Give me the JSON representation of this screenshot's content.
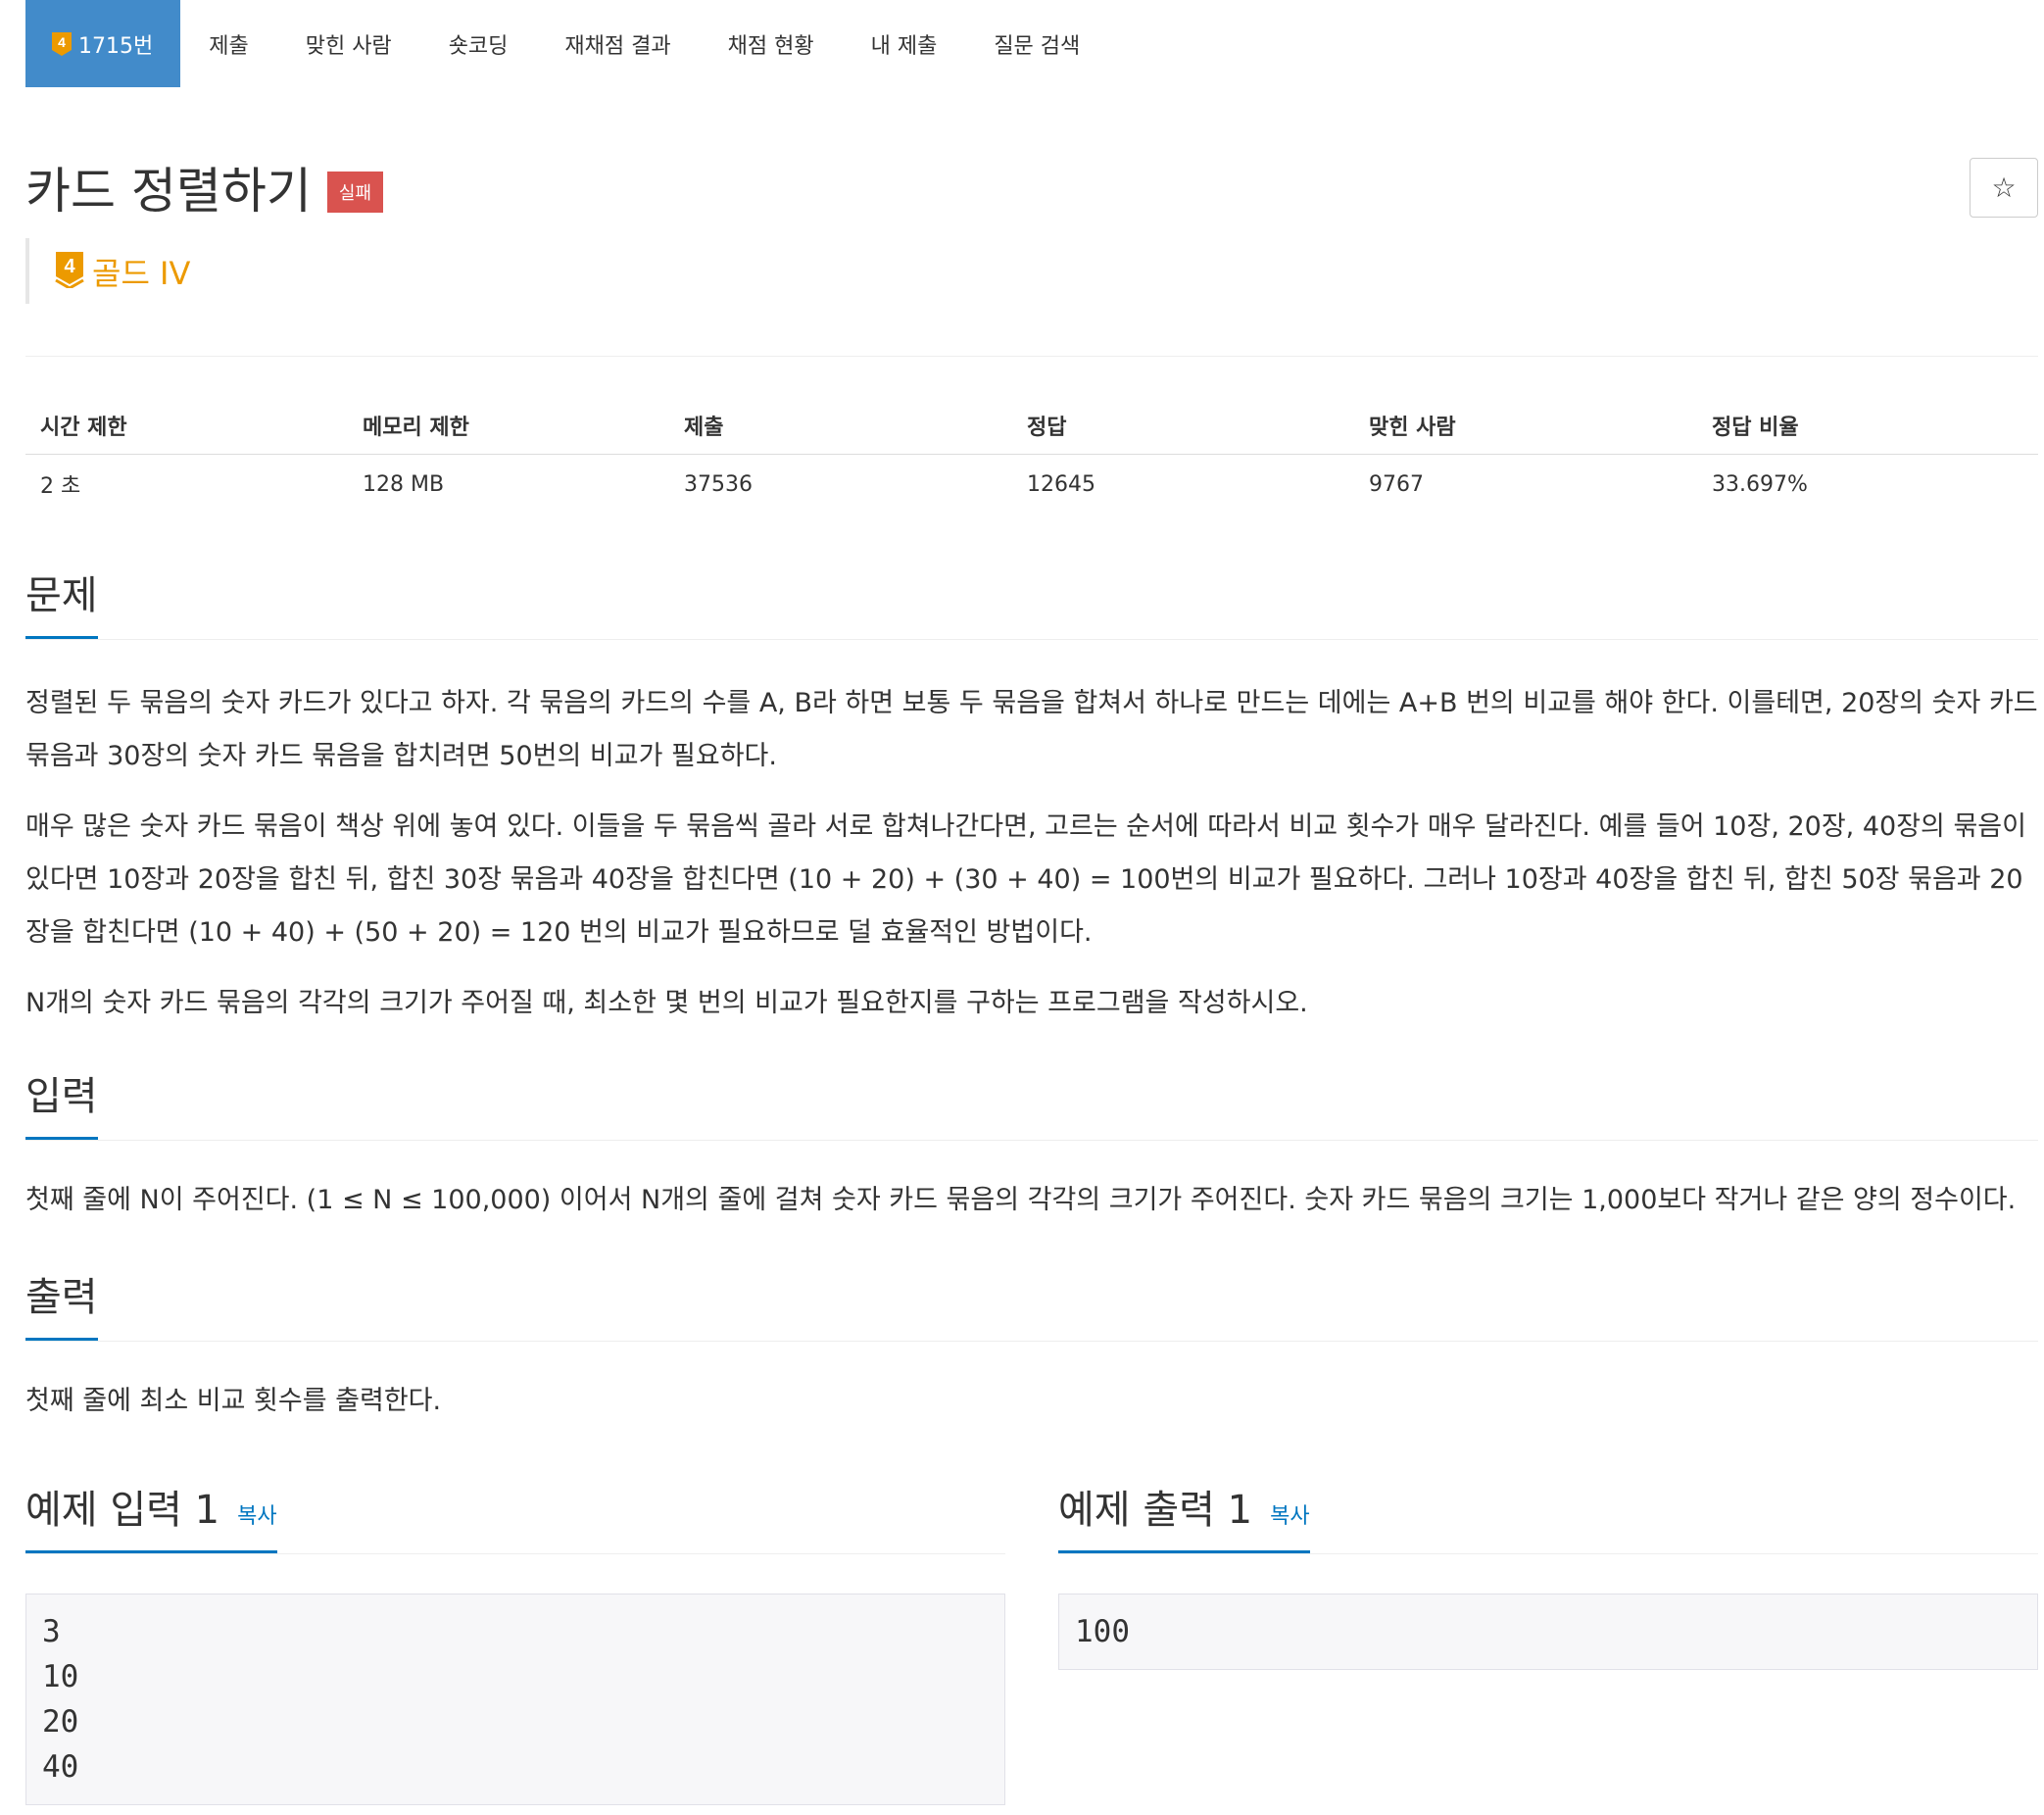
{
  "tabs": [
    {
      "label": "1715번",
      "tier_number": "4"
    },
    {
      "label": "제출"
    },
    {
      "label": "맞힌 사람"
    },
    {
      "label": "숏코딩"
    },
    {
      "label": "재채점 결과"
    },
    {
      "label": "채점 현황"
    },
    {
      "label": "내 제출"
    },
    {
      "label": "질문 검색"
    }
  ],
  "problem": {
    "title": "카드 정렬하기",
    "result_label": "실패",
    "star_icon": "☆",
    "tier": {
      "number": "4",
      "label": "골드 IV",
      "color": "#ec9a00"
    }
  },
  "info": {
    "headers": [
      "시간 제한",
      "메모리 제한",
      "제출",
      "정답",
      "맞힌 사람",
      "정답 비율"
    ],
    "values": [
      "2 초",
      "128 MB",
      "37536",
      "12645",
      "9767",
      "33.697%"
    ]
  },
  "sections": {
    "description": {
      "title": "문제",
      "paragraphs": [
        "정렬된 두 묶음의 숫자 카드가 있다고 하자. 각 묶음의 카드의 수를 A, B라 하면 보통 두 묶음을 합쳐서 하나로 만드는 데에는 A+B 번의 비교를 해야 한다. 이를테면, 20장의 숫자 카드 묶음과 30장의 숫자 카드 묶음을 합치려면 50번의 비교가 필요하다.",
        "매우 많은 숫자 카드 묶음이 책상 위에 놓여 있다. 이들을 두 묶음씩 골라 서로 합쳐나간다면, 고르는 순서에 따라서 비교 횟수가 매우 달라진다. 예를 들어 10장, 20장, 40장의 묶음이 있다면 10장과 20장을 합친 뒤, 합친 30장 묶음과 40장을 합친다면 (10 + 20) + (30 + 40) = 100번의 비교가 필요하다. 그러나 10장과 40장을 합친 뒤, 합친 50장 묶음과 20장을 합친다면 (10 + 40) + (50 + 20) = 120 번의 비교가 필요하므로 덜 효율적인 방법이다.",
        "N개의 숫자 카드 묶음의 각각의 크기가 주어질 때, 최소한 몇 번의 비교가 필요한지를 구하는 프로그램을 작성하시오."
      ]
    },
    "input": {
      "title": "입력",
      "paragraphs": [
        "첫째 줄에 N이 주어진다. (1 ≤ N ≤ 100,000) 이어서 N개의 줄에 걸쳐 숫자 카드 묶음의 각각의 크기가 주어진다. 숫자 카드 묶음의 크기는 1,000보다 작거나 같은 양의 정수이다."
      ]
    },
    "output": {
      "title": "출력",
      "paragraphs": [
        "첫째 줄에 최소 비교 횟수를 출력한다."
      ]
    }
  },
  "samples": {
    "input": {
      "title": "예제 입력 1",
      "copy_label": "복사",
      "text": "3\n10\n20\n40"
    },
    "output": {
      "title": "예제 출력 1",
      "copy_label": "복사",
      "text": "100"
    }
  },
  "colors": {
    "primary": "#428bca",
    "link": "#0076c0",
    "danger": "#d9534f",
    "gold": "#ec9a00"
  }
}
